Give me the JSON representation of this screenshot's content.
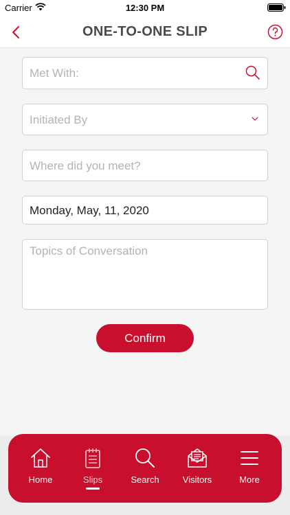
{
  "status_bar": {
    "carrier": "Carrier",
    "time": "12:30 PM"
  },
  "nav": {
    "title": "ONE-TO-ONE SLIP",
    "back_icon": "chevron-left-icon",
    "help_icon": "question-circle-icon"
  },
  "form": {
    "met_with": {
      "placeholder": "Met With:",
      "value": ""
    },
    "initiated_by": {
      "placeholder": "Initiated By",
      "value": ""
    },
    "where_met": {
      "placeholder": "Where did you meet?",
      "value": ""
    },
    "date": {
      "value": "Monday, May, 11, 2020"
    },
    "topics": {
      "placeholder": "Topics of Conversation",
      "value": ""
    },
    "confirm_label": "Confirm"
  },
  "tabs": [
    {
      "label": "Home",
      "icon": "home-icon",
      "active": false
    },
    {
      "label": "Slips",
      "icon": "slips-icon",
      "active": true
    },
    {
      "label": "Search",
      "icon": "search-icon",
      "active": false
    },
    {
      "label": "Visitors",
      "icon": "visitors-icon",
      "active": false
    },
    {
      "label": "More",
      "icon": "menu-icon",
      "active": false
    }
  ],
  "colors": {
    "accent": "#c8102e",
    "background": "#f4f5f5",
    "placeholder": "#b3b3b3"
  }
}
